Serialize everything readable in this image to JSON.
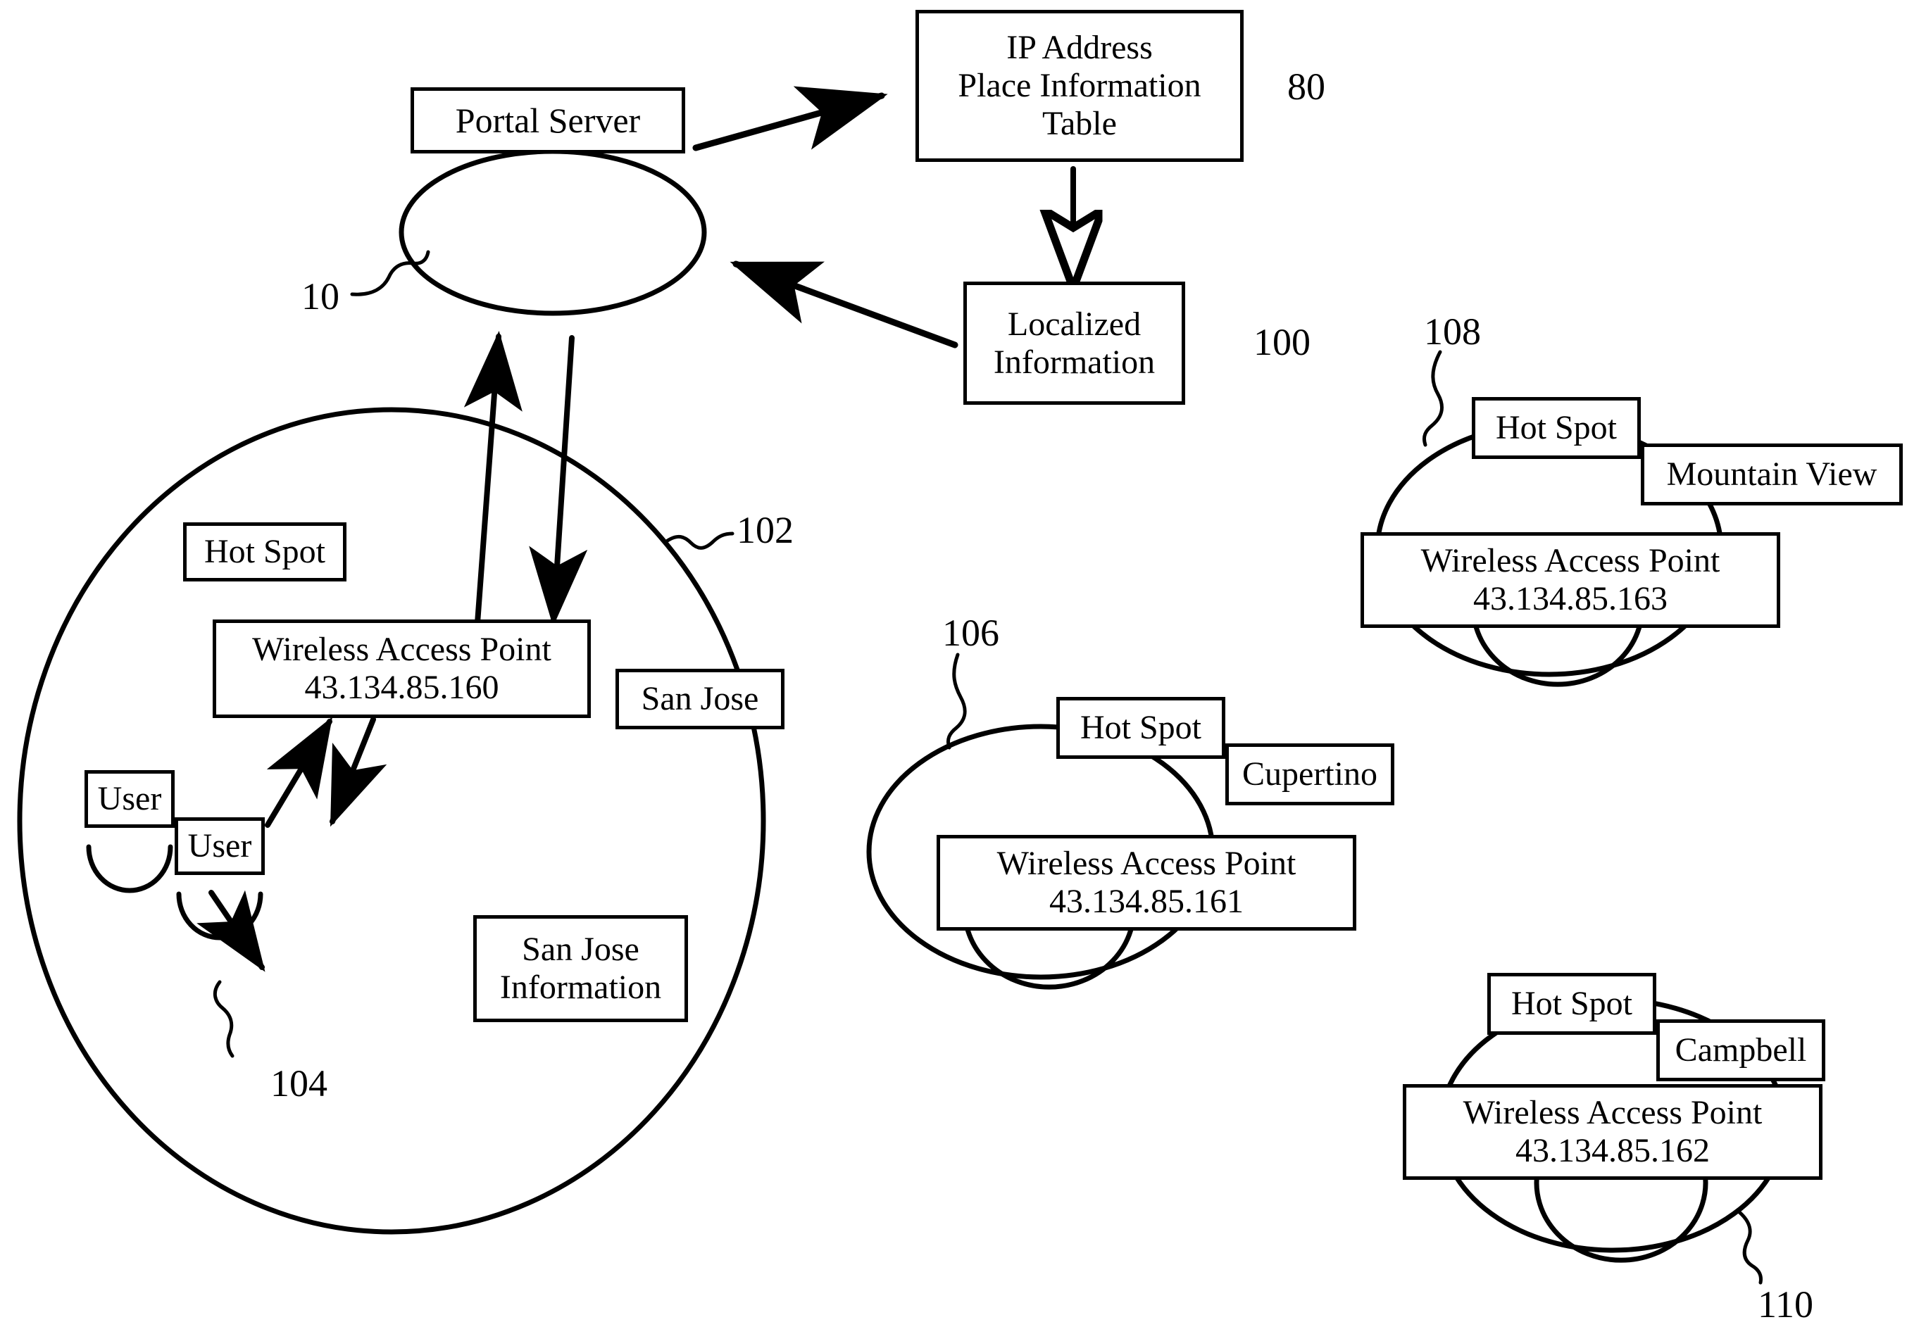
{
  "figure": {
    "title": "Hot Spot Localized Information Delivery Diagram",
    "line_color": "#000000",
    "background_color": "#ffffff"
  },
  "nodes": {
    "portal_server": {
      "label": "Portal Server"
    },
    "ip_table": {
      "line1": "IP Address",
      "line2": "Place Information",
      "line3": "Table"
    },
    "localized_information": {
      "line1": "Localized",
      "line2": "Information"
    },
    "sanjose_hotspot": {
      "hotspot_label": "Hot Spot",
      "place_label": "San Jose",
      "wap_line1": "Wireless Access Point",
      "wap_line2": "43.134.85.160",
      "user_a_label": "User",
      "user_b_label": "User",
      "info_line1": "San Jose",
      "info_line2": "Information"
    },
    "cupertino_hotspot": {
      "hotspot_label": "Hot Spot",
      "place_label": "Cupertino",
      "wap_line1": "Wireless Access Point",
      "wap_line2": "43.134.85.161"
    },
    "mountainview_hotspot": {
      "hotspot_label": "Hot Spot",
      "place_label": "Mountain View",
      "wap_line1": "Wireless Access Point",
      "wap_line2": "43.134.85.163"
    },
    "campbell_hotspot": {
      "hotspot_label": "Hot Spot",
      "place_label": "Campbell",
      "wap_line1": "Wireless Access Point",
      "wap_line2": "43.134.85.162"
    }
  },
  "reference_numerals": {
    "network_cloud": "10",
    "ip_table": "80",
    "localized_information": "100",
    "sanjose_hotspot": "102",
    "user_terminal": "104",
    "cupertino_hotspot": "106",
    "mountainview_hotspot": "108",
    "campbell_hotspot": "110"
  }
}
